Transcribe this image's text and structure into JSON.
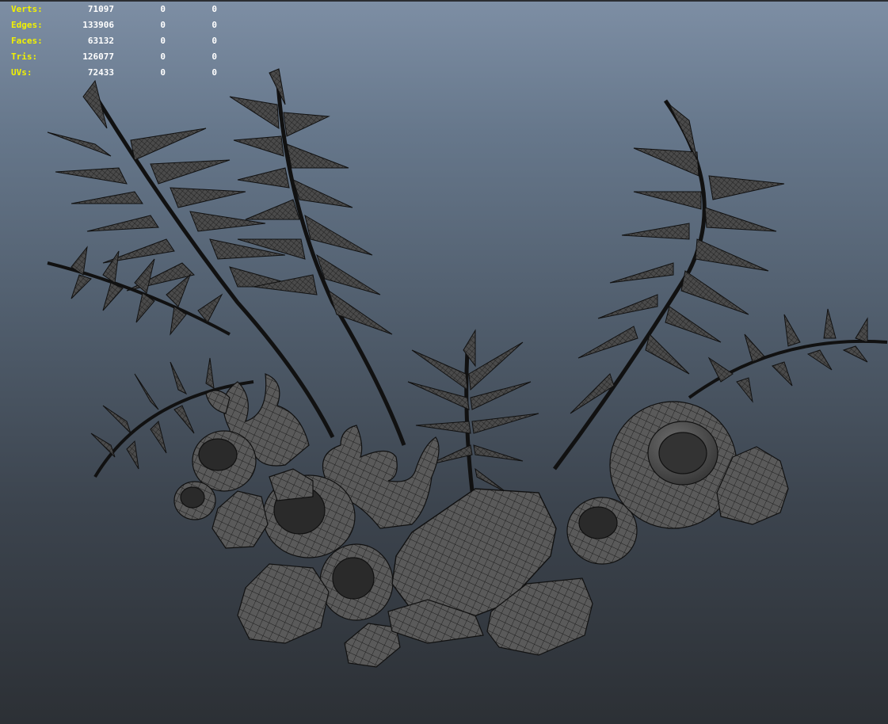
{
  "hud": {
    "rows": [
      {
        "label": "Verts:",
        "total": "71097",
        "selected": "0",
        "component": "0"
      },
      {
        "label": "Edges:",
        "total": "133906",
        "selected": "0",
        "component": "0"
      },
      {
        "label": "Faces:",
        "total": "63132",
        "selected": "0",
        "component": "0"
      },
      {
        "label": "Tris:",
        "total": "126077",
        "selected": "0",
        "component": "0"
      },
      {
        "label": "UVs:",
        "total": "72433",
        "selected": "0",
        "component": "0"
      }
    ]
  },
  "colors": {
    "bg_top": "#7d8ea4",
    "bg_bottom": "#2c3035",
    "hud_label": "#f2f200",
    "hud_value": "#ffffff",
    "mesh_fill": "#5d5d5d",
    "wire": "#1a1a1a"
  }
}
